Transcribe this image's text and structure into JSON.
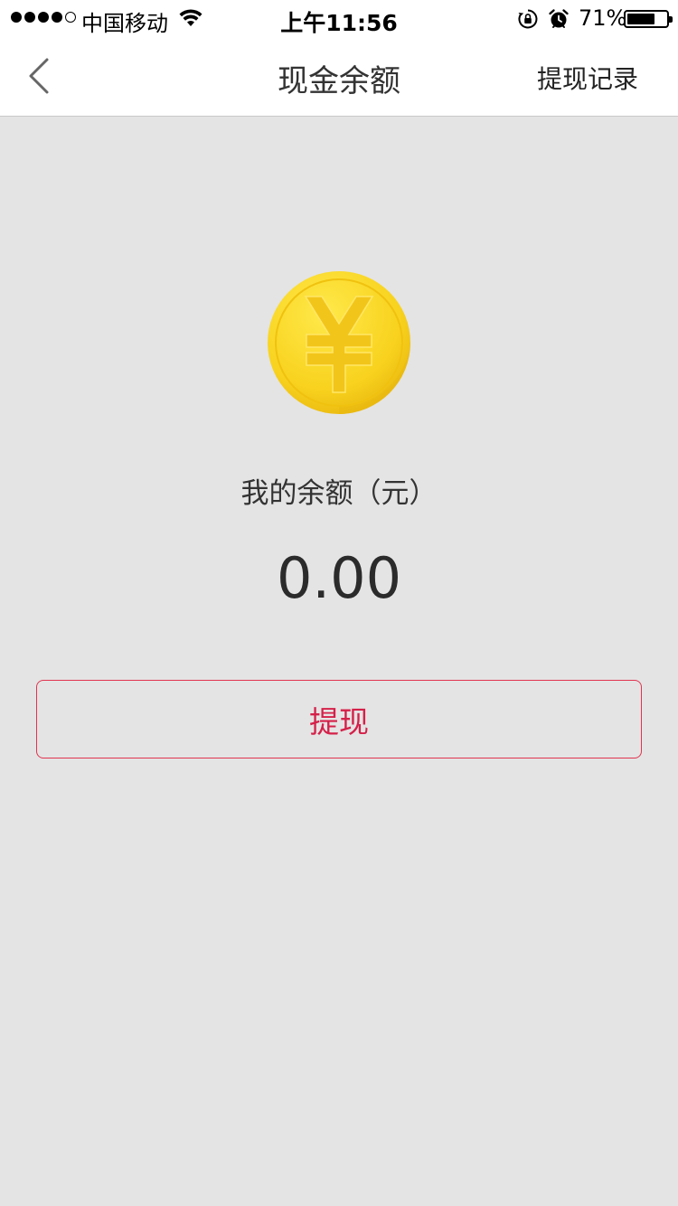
{
  "status_bar": {
    "carrier": "中国移动",
    "time": "上午11:56",
    "battery_percent": "71%",
    "battery_level": 0.71,
    "signal_bars_filled": 4,
    "signal_bars_total": 5,
    "icons": [
      "signal-icon",
      "wifi-icon",
      "orientation-lock-icon",
      "alarm-icon",
      "battery-icon"
    ]
  },
  "nav": {
    "title": "现金余额",
    "right_action": "提现记录",
    "back_icon": "chevron-left-icon"
  },
  "balance": {
    "icon": "yuan-coin-icon",
    "label": "我的余额（元）",
    "amount": "0.00"
  },
  "actions": {
    "withdraw_label": "提现"
  },
  "colors": {
    "background": "#e4e4e4",
    "accent": "#d52049",
    "coin": "#f5cf1e"
  }
}
